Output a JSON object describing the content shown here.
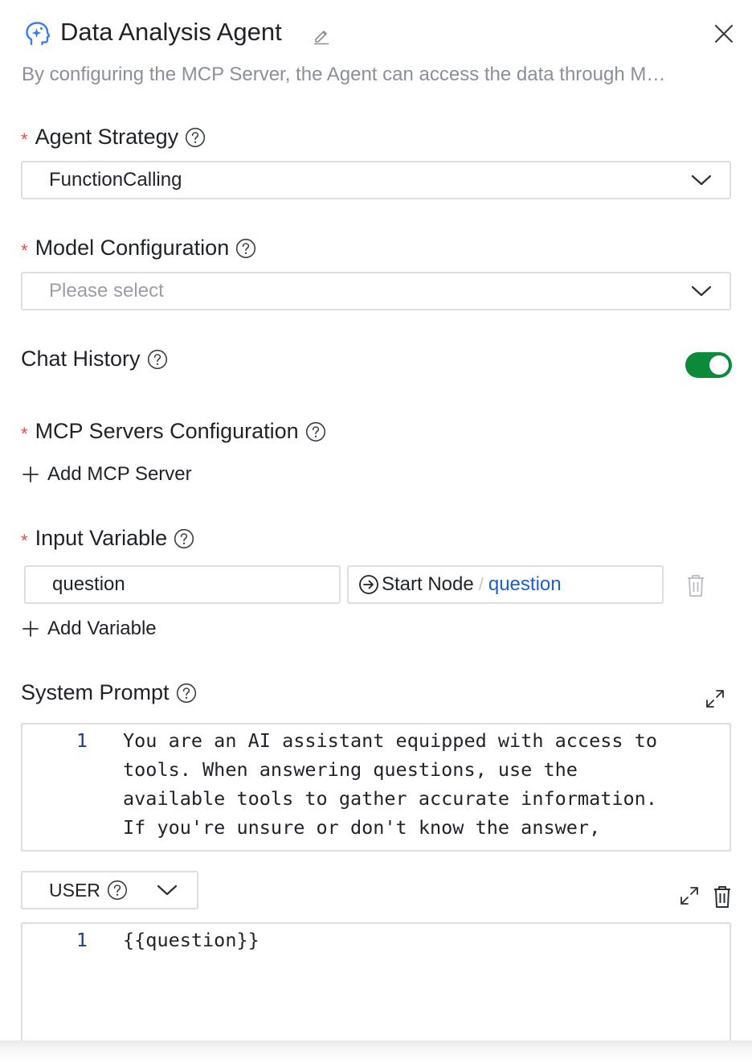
{
  "header": {
    "title": "Data Analysis Agent",
    "subtitle": "By configuring the MCP Server, the Agent can access the data through M…"
  },
  "agent_strategy": {
    "label": "Agent Strategy",
    "required_mark": "*",
    "value": "FunctionCalling"
  },
  "model_configuration": {
    "label": "Model Configuration",
    "required_mark": "*",
    "placeholder": "Please select"
  },
  "chat_history": {
    "label": "Chat History",
    "enabled": true
  },
  "mcp_servers": {
    "label": "MCP Servers Configuration",
    "required_mark": "*",
    "add_label": "Add MCP Server"
  },
  "input_variable": {
    "label": "Input Variable",
    "required_mark": "*",
    "rows": [
      {
        "name": "question",
        "source_node": "Start Node",
        "separator": "/",
        "source_var": "question"
      }
    ],
    "add_label": "Add Variable"
  },
  "system_prompt": {
    "label": "System Prompt",
    "line_number": "1",
    "lines": [
      "You are an AI assistant equipped with access to",
      "tools. When answering questions, use the",
      "available tools to gather accurate information.",
      "If you're unsure or don't know the answer,"
    ]
  },
  "user_message": {
    "role": "USER",
    "line_number": "1",
    "content": "{{question}}"
  },
  "colors": {
    "required": "#e5484d",
    "toggle_on": "#0b8a3a",
    "link_blue": "#1a5fd6",
    "agent_icon": "#3b7cf0"
  }
}
